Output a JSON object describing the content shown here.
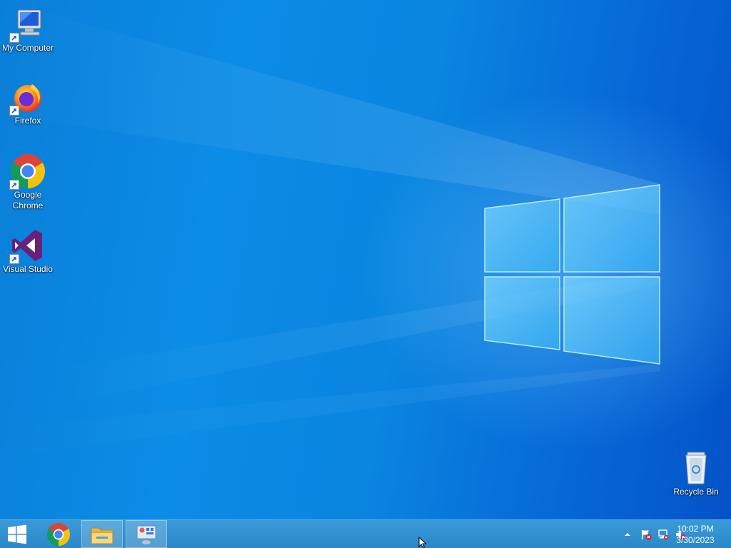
{
  "desktop": {
    "icons": [
      {
        "label": "My Computer"
      },
      {
        "label": "Firefox"
      },
      {
        "label": "Google Chrome"
      },
      {
        "label": "Visual Studio"
      },
      {
        "label": "Recycle Bin"
      }
    ]
  },
  "taskbar": {
    "start_icon": "windows-logo-icon",
    "pinned": [
      {
        "icon": "chrome-icon"
      },
      {
        "icon": "file-explorer-icon"
      },
      {
        "icon": "control-panel-icon"
      }
    ],
    "tray": {
      "icons": [
        "show-hidden-icons-chevron",
        "action-center-flag-icon",
        "network-icon",
        "volume-muted-icon"
      ],
      "time": "10:02 PM",
      "date": "3/30/2023"
    }
  },
  "colors": {
    "desktop_blue": "#0a85e0",
    "taskbar_blue": "#2b8fd0"
  }
}
